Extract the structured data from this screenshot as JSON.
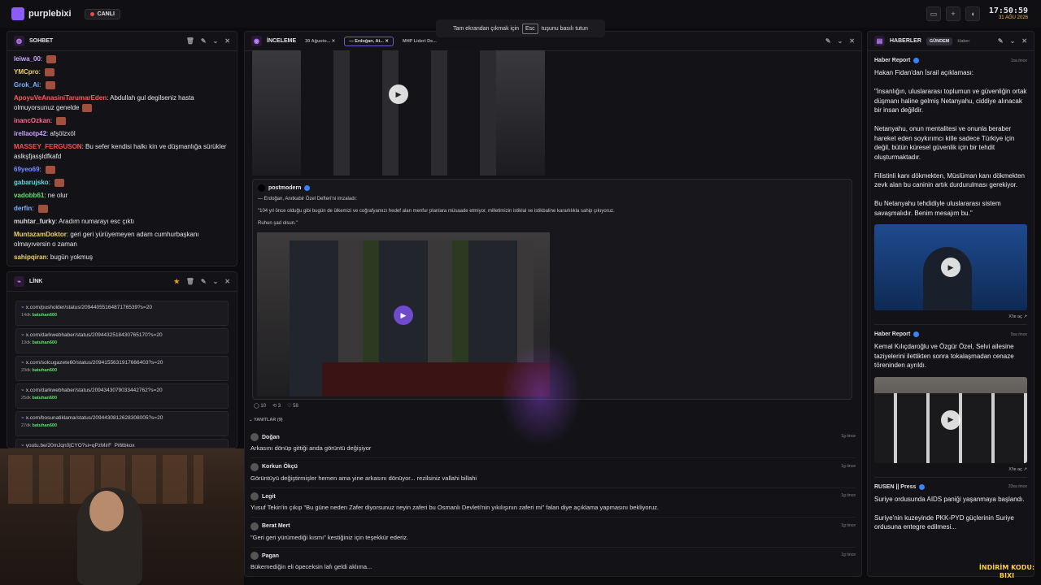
{
  "topbar": {
    "brand": "purplebixi",
    "live": "CANLI",
    "time": "17:50:59",
    "date": "31 AĞU 2026"
  },
  "toast": {
    "before": "Tam ekrandan çıkmak için",
    "key": "Esc",
    "after": "tuşunu basılı tutun"
  },
  "chat": {
    "title": "SOHBET",
    "messages": [
      {
        "user": "leiwa_00",
        "color": "#c9a3ff",
        "text": "",
        "emote": true
      },
      {
        "user": "YMCpro",
        "color": "#f0d060",
        "text": "",
        "emote": true
      },
      {
        "user": "Grok_Ai",
        "color": "#7fb0ff",
        "text": "",
        "emote": true
      },
      {
        "user": "ApoyuVeAnasiniTarumarEden",
        "color": "#ff5a5a",
        "text": "Abdullah gul degilseniz hasta olmuyorsunuz genelde",
        "emote": true
      },
      {
        "user": "inancOzkan",
        "color": "#ff6b8a",
        "text": "",
        "emote": true
      },
      {
        "user": "irellaotp42",
        "color": "#c9a3ff",
        "text": "afşölzxöl",
        "emote": false
      },
      {
        "user": "MASSEY_FERGUSON",
        "color": "#ff4d4d",
        "text": "Bu sefer kendisi halkı kin ve düşmanlığa sürükler aslkşfjasşldfkafd",
        "emote": false
      },
      {
        "user": "69yeo69",
        "color": "#7b8cff",
        "text": "",
        "emote": true
      },
      {
        "user": "gabarujsko",
        "color": "#58e0e0",
        "text": "",
        "emote": true
      },
      {
        "user": "vadobb61",
        "color": "#5ee068",
        "text": "ne olur",
        "emote": false
      },
      {
        "user": "derfin",
        "color": "#7fb0ff",
        "text": "",
        "emote": true
      },
      {
        "user": "muhtar_furky",
        "color": "#d7d7dd",
        "text": "Aradım numarayı esc çıktı",
        "emote": false
      },
      {
        "user": "MuntazamDoktor",
        "color": "#f0d060",
        "text": "geri geri yürüyemeyen adam cumhurbaşkanı olmayıversin o zaman",
        "emote": false
      },
      {
        "user": "sahipqiran",
        "color": "#f0d060",
        "text": "bugün yokmuş",
        "emote": false
      }
    ]
  },
  "links": {
    "title": "LİNK",
    "items": [
      {
        "url": "x.com/pusholder/status/2094405516487176539?s=20",
        "ago": "14dk",
        "user": "batuhan600"
      },
      {
        "url": "x.com/darkwebhaber/status/2094432518430765170?s=20",
        "ago": "19dk",
        "user": "batuhan600"
      },
      {
        "url": "x.com/solcugazete60/status/2094155631917666403?s=20",
        "ago": "23dk",
        "user": "batuhan600"
      },
      {
        "url": "x.com/darkwebhaber/status/2094343079033442762?s=20",
        "ago": "25dk",
        "user": "batuhan600"
      },
      {
        "url": "x.com/bosunatiklama/status/2094430812628308005?s=20",
        "ago": "27dk",
        "user": "batuhan600"
      },
      {
        "url": "youtu.be/20mJqn0jCYO?si=qPzMirF_Pi6tbkox",
        "ago": "",
        "user": ""
      }
    ]
  },
  "review": {
    "title": "İNCELEME",
    "tabs": [
      "30 Ağusto...",
      "— Erdoğan, At...",
      "MHP Lideri De..."
    ],
    "post": {
      "author": "postmodern",
      "line1": "— Erdoğan, Anıtkabir Özel Defteri'ni imzaladı:",
      "line2": "\"104 yıl önce olduğu gibi bugün de ülkemizi ve coğrafyamızı hedef alan menfur planlara müsaade etmiyor, milletimizin istiklal ve istikbaline kararlılıkla sahip çıkıyoruz.",
      "line3": "Ruhun şad olsun.\"",
      "replies": "10",
      "reposts": "3",
      "likes": "58"
    },
    "replies_label": "YANITLAR (9)",
    "replies": [
      {
        "user": "Doğan",
        "time": "1g önce",
        "text": "Arkasını dönüp gittiği anda görüntü değişiyor"
      },
      {
        "user": "Korkun Ökçü",
        "time": "1g önce",
        "text": "Görüntüyü değiştirmişler hemen ama yine arkasını dönüyor... rezilsiniz vallahi billahi"
      },
      {
        "user": "Legit",
        "time": "1g önce",
        "text": "Yusuf Tekin'in çıkıp \"Bu güne neden Zafer diyorsunuz neyin zaferi bu Osmanlı Devleti'nin yıkılışının zaferi mi\" falan diye açıklama yapmasını bekliyoruz."
      },
      {
        "user": "Berat Mert",
        "time": "1g önce",
        "text": "\"Geri geri yürümediği kısmı\" kestiğiniz için teşekkür ederiz."
      },
      {
        "user": "Pagan",
        "time": "1g önce",
        "text": "Bükemediğin eli öpeceksin lafı geldi aklıma..."
      }
    ]
  },
  "news": {
    "title": "HABERLER",
    "tab_active": "GÜNDEM",
    "tab_other": "Haber",
    "items": [
      {
        "source": "Haber Report",
        "time": "1sa önce",
        "text": "Hakan Fidan'dan İsrail açıklaması:\n\n\"İnsanlığın, uluslararası toplumun ve güvenliğin ortak düşmanı haline gelmiş Netanyahu, ciddiye alınacak bir insan değildir.\n\nNetanyahu, onun mentalitesi ve onunla beraber hareket eden soykırımcı kitle sadece Türkiye için değil, bütün küresel güvenlik için bir tehdit oluşturmaktadır.\n\nFilistinli kanı dökmekten, Müslüman kanı dökmekten zevk alan bu caninin artık durdurulması gerekiyor.\n\nBu Netanyahu tehdidiyle uluslararası sistem savaşmalıdır. Benim mesajım bu.\"",
        "link": "X'te aç"
      },
      {
        "source": "Haber Report",
        "time": "5sa önce",
        "text": "Kemal Kılıçdaroğlu ve Özgür Özel, Selvi ailesine taziyelerini ilettikten sonra tokalaşmadan cenaze töreninden ayrıldı.",
        "link": "X'te aç"
      },
      {
        "source": "RUSEN || Press",
        "time": "33sa önce",
        "text": "Suriye ordusunda AIDS paniği yaşanmaya başlandı.\n\nSuriye'nin kuzeyinde PKK-PYD güçlerinin Suriye ordusuna entegre edilmesi...",
        "link": ""
      }
    ]
  },
  "overlay": {
    "promo": "İNDİRİM KODU:",
    "promo2": "BIXI"
  }
}
